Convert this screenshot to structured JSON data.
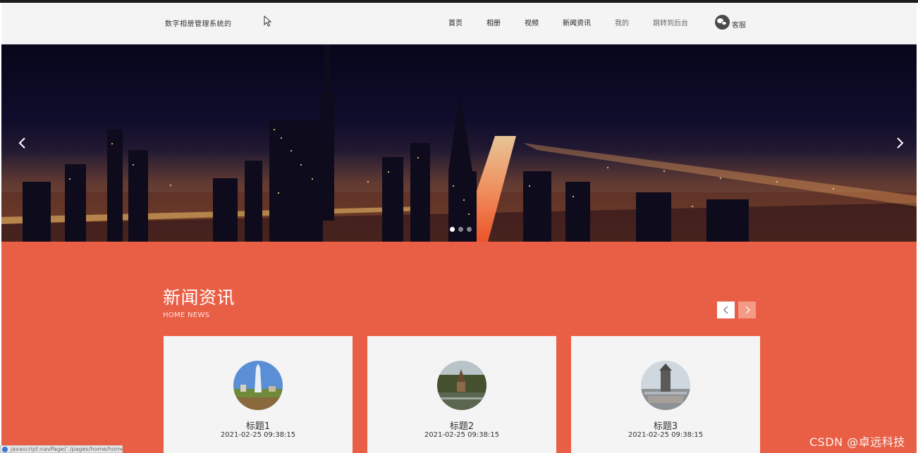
{
  "header": {
    "brand": "数字相册管理系统的",
    "nav": [
      {
        "label": "首页"
      },
      {
        "label": "相册"
      },
      {
        "label": "视频"
      },
      {
        "label": "新闻资讯"
      },
      {
        "label": "我的"
      },
      {
        "label": "跳转到后台"
      }
    ],
    "service_label": "客服"
  },
  "banner": {
    "slide_count": 3,
    "active_slide": 1
  },
  "news": {
    "title": "新闻资讯",
    "subtitle": "HOME NEWS",
    "items": [
      {
        "title": "标题1",
        "time": "2021-02-25 09:38:15"
      },
      {
        "title": "标题2",
        "time": "2021-02-25 09:38:15"
      },
      {
        "title": "标题3",
        "time": "2021-02-25 09:38:15"
      }
    ]
  },
  "status_bar": {
    "url": "javascript:navPage('./pages/home/home.jsp')"
  },
  "watermark": "CSDN @卓远科技",
  "colors": {
    "accent": "#e95f46",
    "header_bg": "#f4f4f4",
    "card_bg": "#f4f4f4"
  }
}
